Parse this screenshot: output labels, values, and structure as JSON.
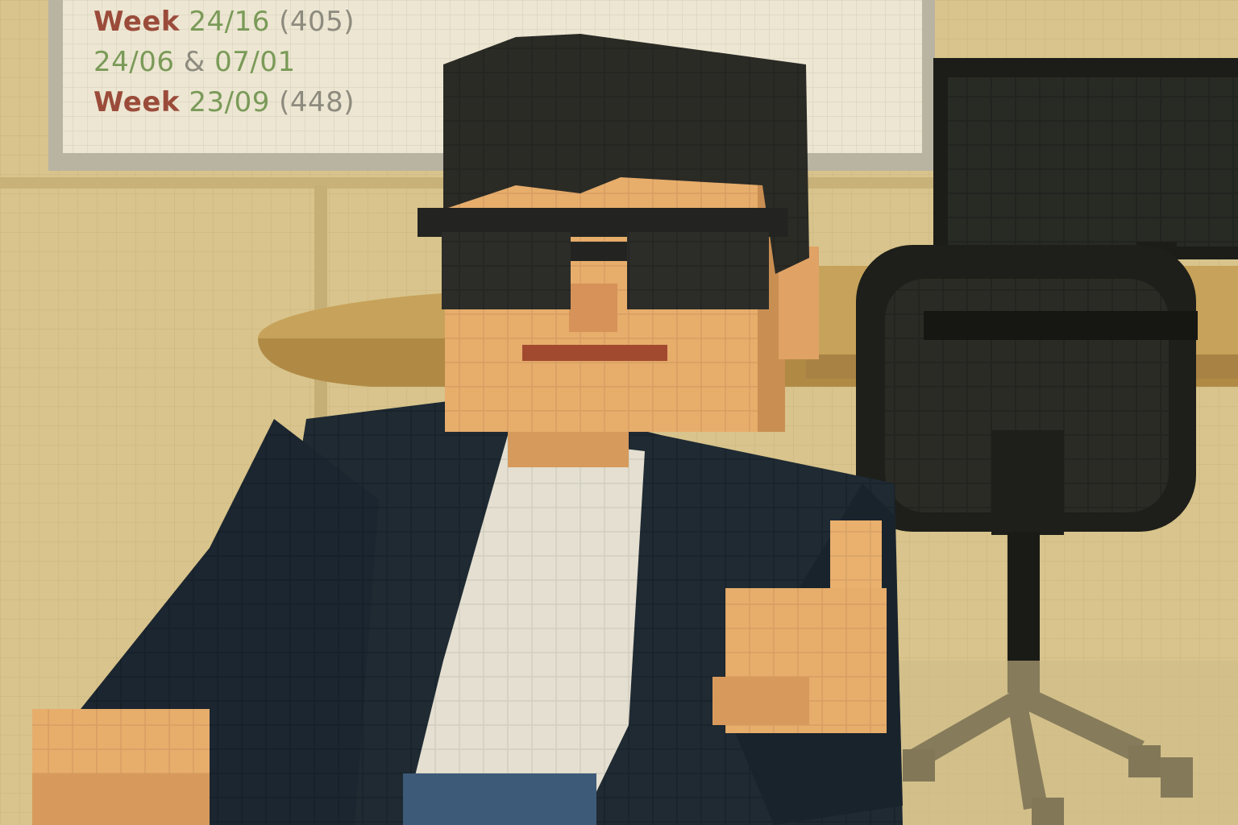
{
  "whiteboard": {
    "lines": [
      {
        "word": "Week",
        "date": "24/16",
        "count": "(405)"
      },
      {
        "word": "",
        "date": "24/06",
        "amp": "&",
        "date2": "07/01"
      },
      {
        "word": "Week",
        "date": "23/09",
        "count": "(448)"
      }
    ]
  },
  "palette": {
    "wall": "#d8c48c",
    "whiteboard": "#ece6d2",
    "hair": "#2b2b26",
    "skin": "#e7ad6b",
    "jacket": "#1f2a33",
    "shirt": "#e4dfd0",
    "chair": "#1e1f1a",
    "desk": "#c7a25a",
    "text_red": "#9b4b3a",
    "text_green": "#7a9a58"
  }
}
